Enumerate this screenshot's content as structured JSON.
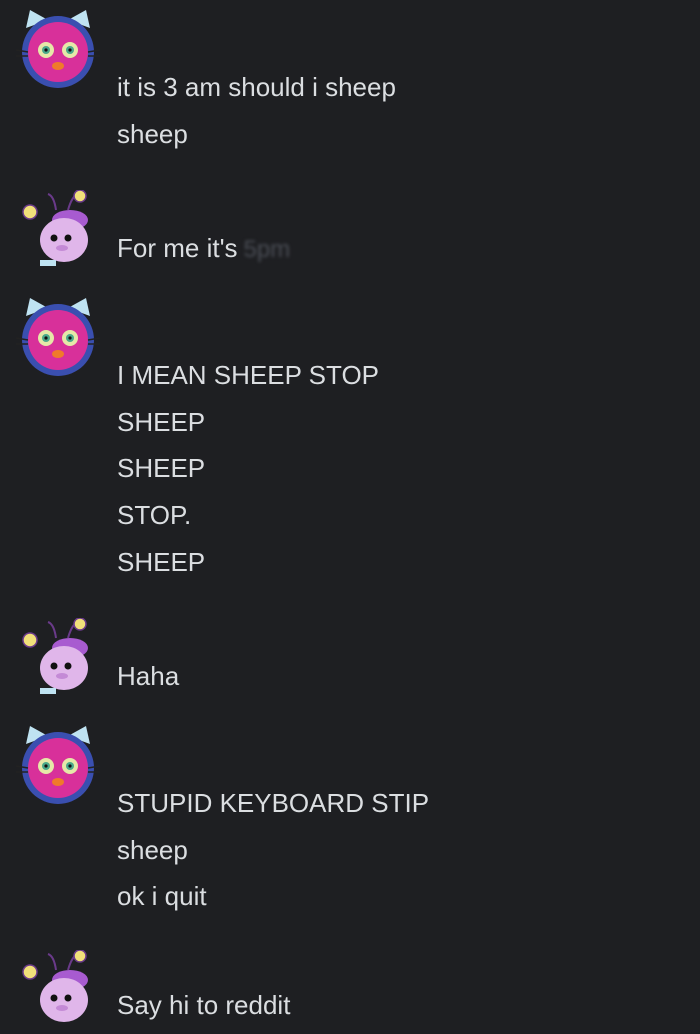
{
  "messages": [
    {
      "user": "cat",
      "avatar_icon": "pink-cat-monster-avatar-icon",
      "lines": [
        "it is 3 am should i sheep",
        "sheep"
      ]
    },
    {
      "user": "snail",
      "avatar_icon": "purple-snail-creature-avatar-icon",
      "lines": [
        "For me it's"
      ],
      "blurred_suffix": "5pm"
    },
    {
      "user": "cat",
      "avatar_icon": "pink-cat-monster-avatar-icon",
      "lines": [
        "I MEAN SHEEP STOP",
        "SHEEP",
        "SHEEP",
        "STOP.",
        "SHEEP"
      ]
    },
    {
      "user": "snail",
      "avatar_icon": "purple-snail-creature-avatar-icon",
      "lines": [
        "Haha"
      ]
    },
    {
      "user": "cat",
      "avatar_icon": "pink-cat-monster-avatar-icon",
      "lines": [
        "STUPID KEYBOARD STIP",
        "sheep",
        "ok i quit"
      ]
    },
    {
      "user": "snail",
      "avatar_icon": "purple-snail-creature-avatar-icon",
      "lines": [
        "Say hi to reddit"
      ]
    }
  ],
  "colors": {
    "background": "#1e1f22",
    "text": "#dbdee1",
    "cat_avatar_face": "#d8309a",
    "snail_avatar_body": "#e0b6ea"
  }
}
